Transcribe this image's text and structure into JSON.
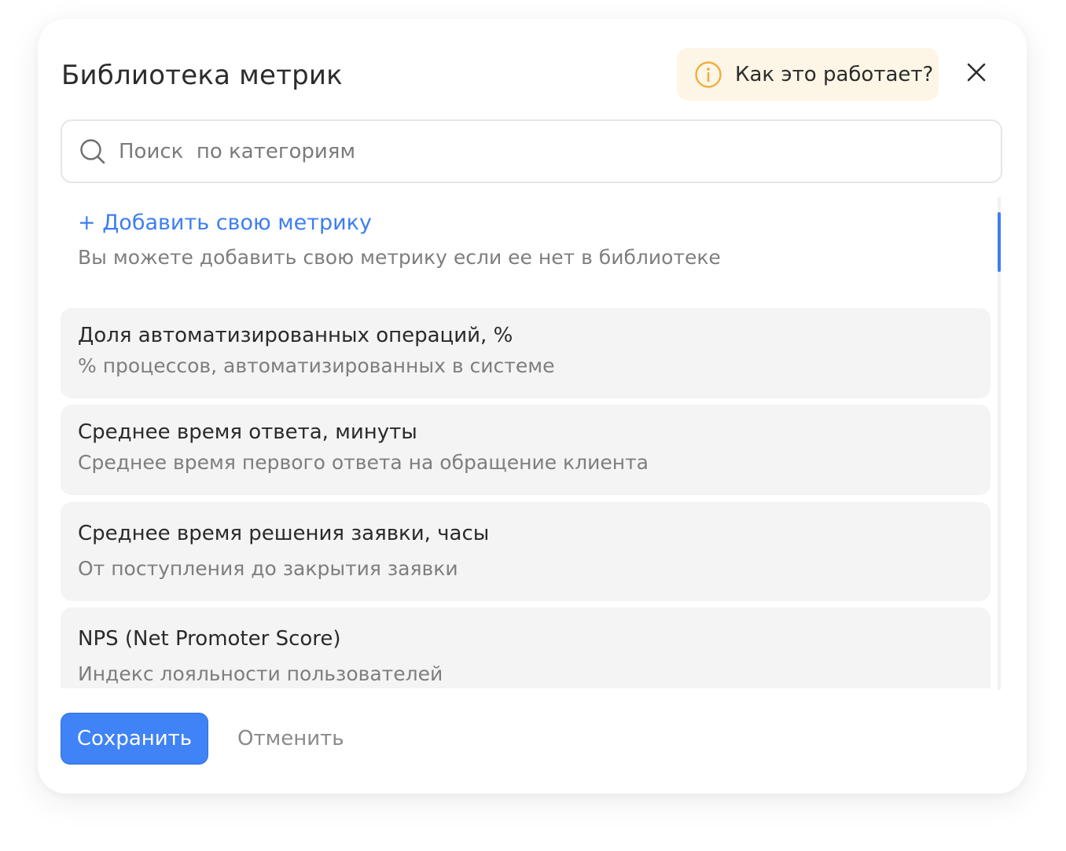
{
  "modal": {
    "title": "Библиотека метрик",
    "help_label": "Как это работает?",
    "help_icon": "info-circle-icon",
    "close_icon": "close-icon"
  },
  "search": {
    "placeholder": "Поиск  по категориям",
    "value": "",
    "icon": "search-icon"
  },
  "list": {
    "add_link": "+ Добавить свою метрику",
    "add_hint": "Вы можете добавить свою метрику если ее нет в библиотеке",
    "items": [
      {
        "title": "Доля автоматизированных операций, %",
        "description": "% процессов, автоматизированных в системе"
      },
      {
        "title": "Среднее время ответа, минуты",
        "description": "Среднее время первого ответа на обращение клиента"
      },
      {
        "title": "Среднее время решения заявки, часы",
        "description": "От поступления до закрытия заявки"
      },
      {
        "title": "NPS (Net Promoter Score)",
        "description": "Индекс лояльности пользователей"
      }
    ]
  },
  "footer": {
    "save_label": "Сохранить",
    "cancel_label": "Отменить"
  },
  "colors": {
    "accent": "#3f83f6",
    "help_bg": "#fdf6e6",
    "help_icon": "#f0ad3c",
    "card_bg": "#f4f4f4"
  }
}
